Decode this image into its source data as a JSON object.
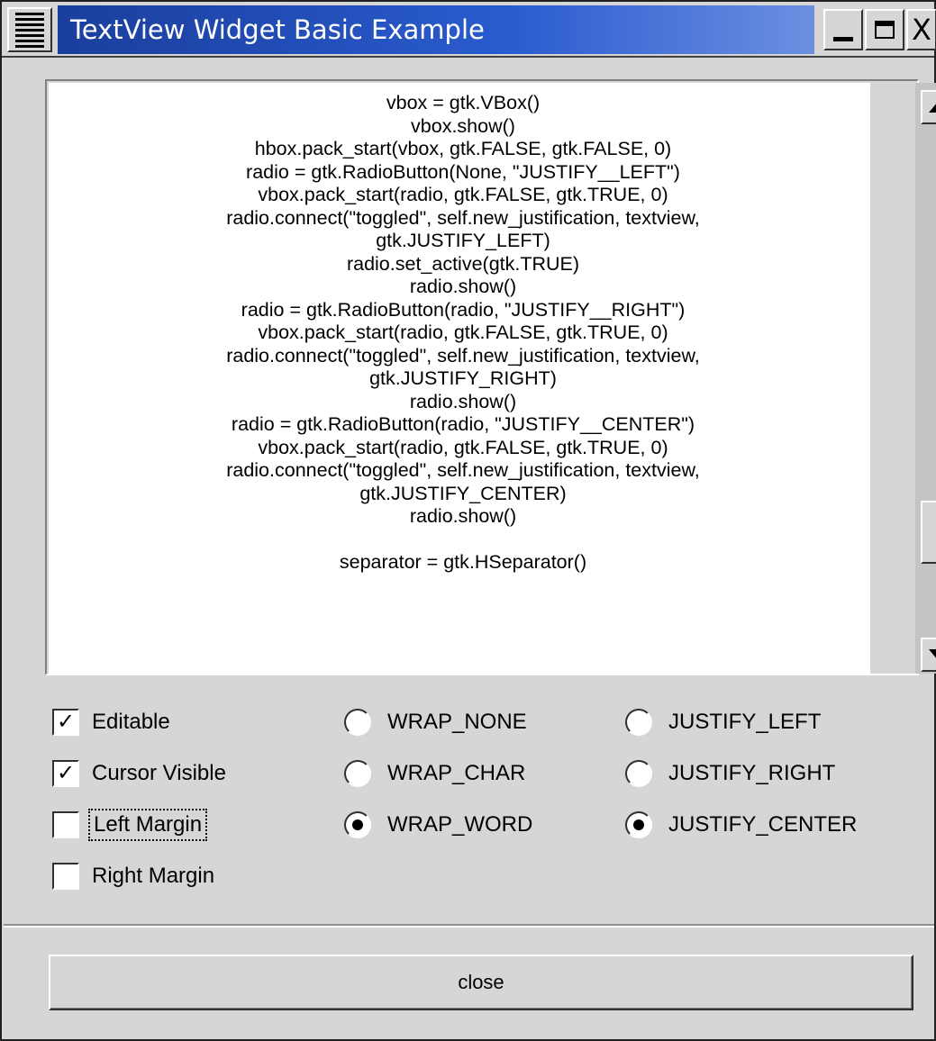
{
  "window": {
    "title": "TextView Widget Basic Example",
    "close_glyph": "X"
  },
  "textview": {
    "lines": [
      "vbox = gtk.VBox()",
      "vbox.show()",
      "hbox.pack_start(vbox, gtk.FALSE, gtk.FALSE, 0)",
      "radio = gtk.RadioButton(None, \"JUSTIFY__LEFT\")",
      "vbox.pack_start(radio, gtk.FALSE, gtk.TRUE, 0)",
      "radio.connect(\"toggled\", self.new_justification, textview,",
      "gtk.JUSTIFY_LEFT)",
      "radio.set_active(gtk.TRUE)",
      "radio.show()",
      "radio = gtk.RadioButton(radio, \"JUSTIFY__RIGHT\")",
      "vbox.pack_start(radio, gtk.FALSE, gtk.TRUE, 0)",
      "radio.connect(\"toggled\", self.new_justification, textview,",
      "gtk.JUSTIFY_RIGHT)",
      "radio.show()",
      "radio = gtk.RadioButton(radio, \"JUSTIFY__CENTER\")",
      "vbox.pack_start(radio, gtk.FALSE, gtk.TRUE, 0)",
      "radio.connect(\"toggled\", self.new_justification, textview,",
      "gtk.JUSTIFY_CENTER)",
      "radio.show()",
      "",
      "separator = gtk.HSeparator()"
    ]
  },
  "checkboxes": [
    {
      "label": "Editable",
      "checked": true,
      "mark": "✓"
    },
    {
      "label": "Cursor Visible",
      "checked": true,
      "mark": "✓"
    },
    {
      "label": "Left Margin",
      "checked": false,
      "mark": ""
    },
    {
      "label": "Right Margin",
      "checked": false,
      "mark": ""
    }
  ],
  "wrap_options": [
    {
      "label": "WRAP_NONE",
      "selected": false
    },
    {
      "label": "WRAP_CHAR",
      "selected": false
    },
    {
      "label": "WRAP_WORD",
      "selected": true
    }
  ],
  "justify_options": [
    {
      "label": "JUSTIFY_LEFT",
      "selected": false
    },
    {
      "label": "JUSTIFY_RIGHT",
      "selected": false
    },
    {
      "label": "JUSTIFY_CENTER",
      "selected": true
    }
  ],
  "close_button": {
    "label": "close"
  }
}
